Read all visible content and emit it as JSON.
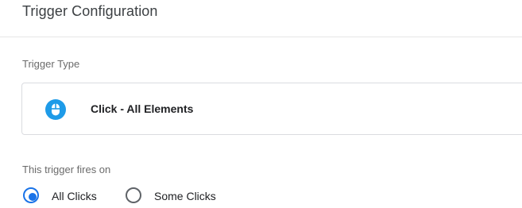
{
  "panel": {
    "title": "Trigger Configuration"
  },
  "trigger_type": {
    "section_label": "Trigger Type",
    "selected_name": "Click - All Elements",
    "icon": "mouse-icon",
    "icon_color": "#1e9be8"
  },
  "fires_on": {
    "section_label": "This trigger fires on",
    "options": [
      {
        "label": "All Clicks",
        "selected": true
      },
      {
        "label": "Some Clicks",
        "selected": false
      }
    ],
    "accent_color": "#1a73e8"
  }
}
